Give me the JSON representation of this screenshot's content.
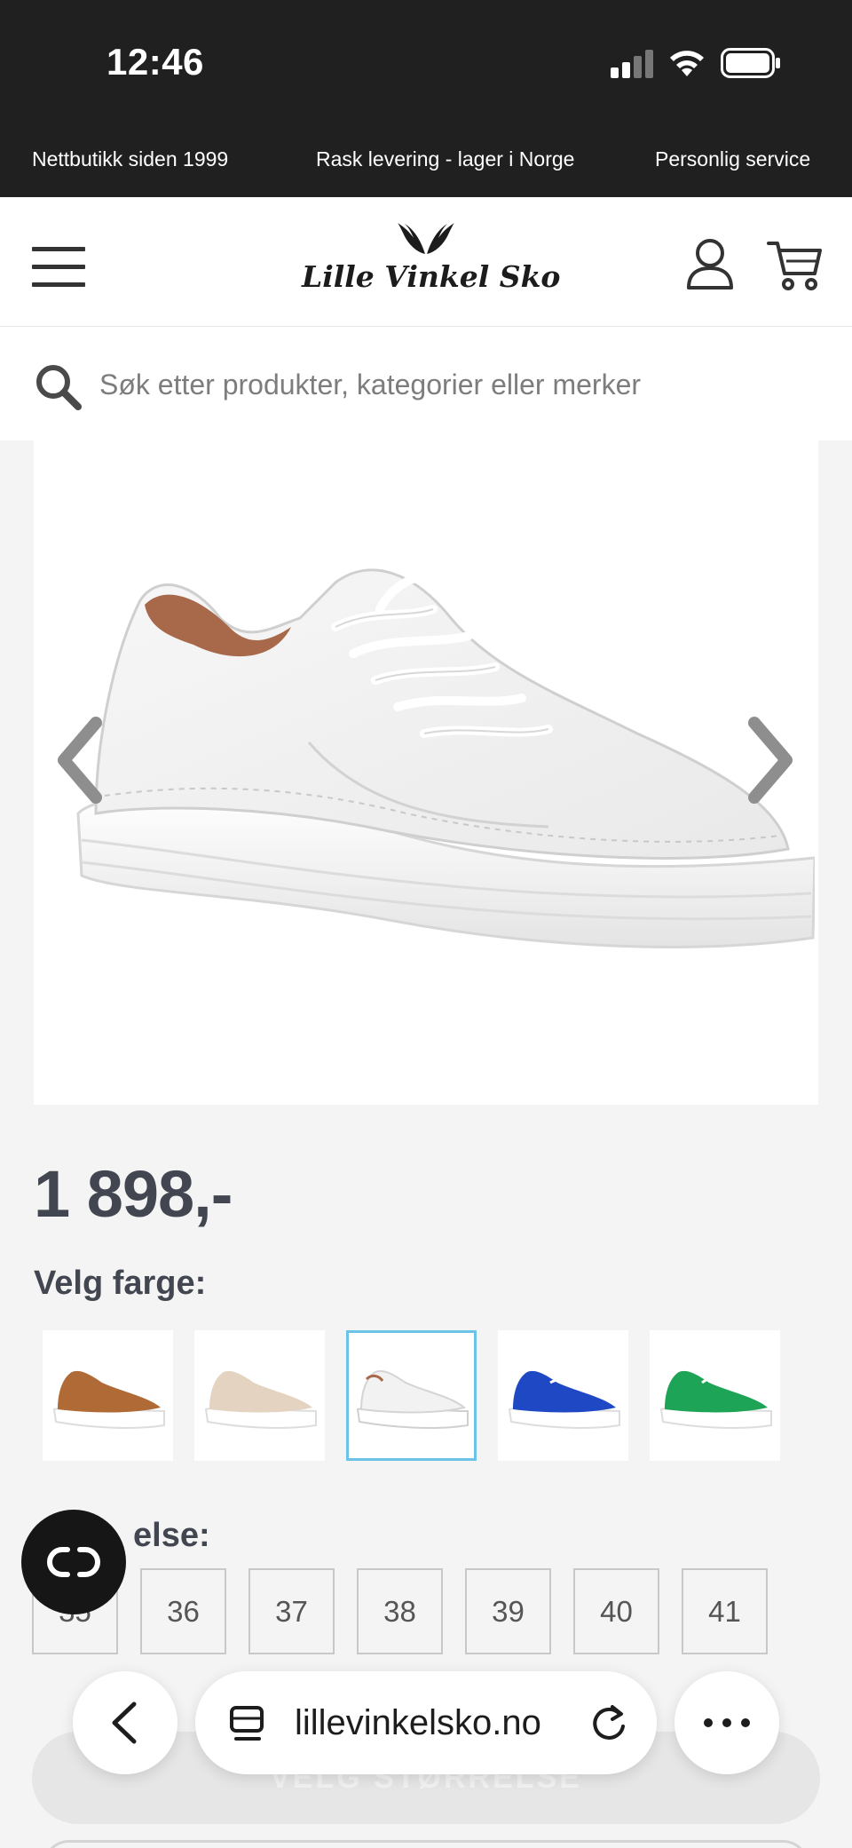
{
  "status_bar": {
    "time": "12:46"
  },
  "promo": {
    "items": [
      "Nettbutikk siden 1999",
      "Rask levering - lager i Norge",
      "Personlig service"
    ]
  },
  "header": {
    "logo_text": "Lille Vinkel Sko",
    "icons": [
      "menu-icon",
      "user-icon",
      "cart-icon"
    ]
  },
  "search": {
    "placeholder": "Søk etter produkter, kategorier eller merker"
  },
  "product": {
    "price": "1 898,-",
    "color_label": "Velg farge:",
    "colors": [
      {
        "name": "brown",
        "hex": "#b06a35",
        "selected": false
      },
      {
        "name": "beige",
        "hex": "#e4d3c0",
        "selected": false
      },
      {
        "name": "white",
        "hex": "#f2f2f2",
        "selected": true
      },
      {
        "name": "blue",
        "hex": "#1f49c4",
        "selected": false
      },
      {
        "name": "green",
        "hex": "#1ea456",
        "selected": false
      }
    ],
    "size_label_visible": "else:",
    "sizes": [
      "35",
      "36",
      "37",
      "38",
      "39",
      "40",
      "41"
    ],
    "cta_label": "VELG STØRRELSE"
  },
  "browser": {
    "url": "lillevinkelsko.no",
    "icons": [
      "back-icon",
      "tabs-icon",
      "reload-icon",
      "more-icon"
    ]
  },
  "colors": {
    "selection_border": "#6cc3e8",
    "text_dark": "#424650",
    "top_bar": "#202020"
  }
}
